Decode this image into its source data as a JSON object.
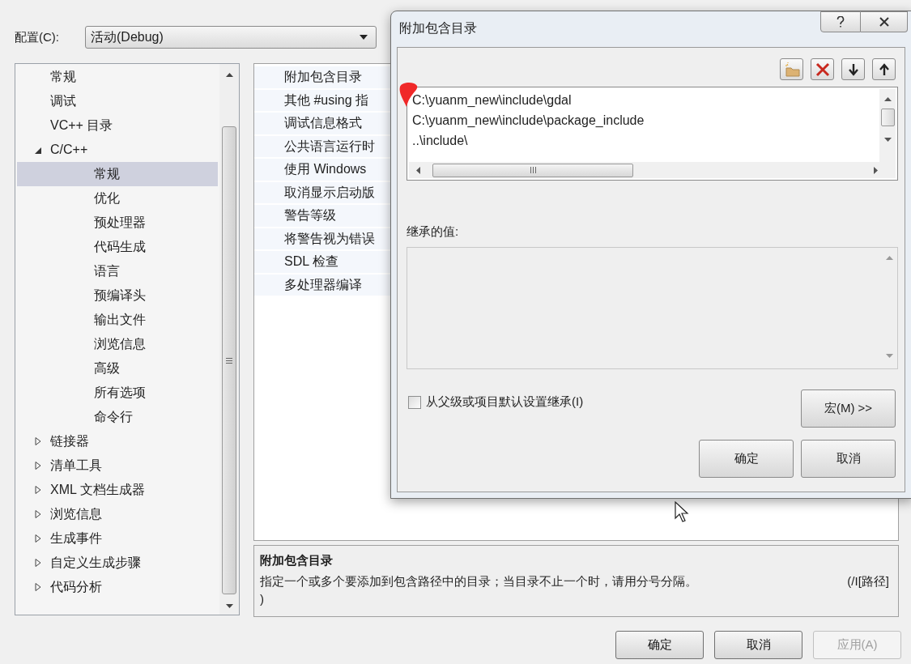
{
  "config": {
    "label": "配置(C):",
    "value": "活动(Debug)"
  },
  "tree": [
    {
      "label": "常规",
      "selected": false
    },
    {
      "label": "调试",
      "selected": false
    },
    {
      "label": "VC++ 目录",
      "selected": false
    },
    {
      "label": "C/C++",
      "selected": false,
      "expanded": true,
      "children": [
        {
          "label": "常规",
          "selected": true
        },
        {
          "label": "优化",
          "selected": false
        },
        {
          "label": "预处理器",
          "selected": false
        },
        {
          "label": "代码生成",
          "selected": false
        },
        {
          "label": "语言",
          "selected": false
        },
        {
          "label": "预编译头",
          "selected": false
        },
        {
          "label": "输出文件",
          "selected": false
        },
        {
          "label": "浏览信息",
          "selected": false
        },
        {
          "label": "高级",
          "selected": false
        },
        {
          "label": "所有选项",
          "selected": false
        },
        {
          "label": "命令行",
          "selected": false
        }
      ]
    },
    {
      "label": "链接器",
      "selected": false,
      "expanded": false
    },
    {
      "label": "清单工具",
      "selected": false,
      "expanded": false
    },
    {
      "label": "XML 文档生成器",
      "selected": false,
      "expanded": false
    },
    {
      "label": "浏览信息",
      "selected": false,
      "expanded": false
    },
    {
      "label": "生成事件",
      "selected": false,
      "expanded": false
    },
    {
      "label": "自定义生成步骤",
      "selected": false,
      "expanded": false
    },
    {
      "label": "代码分析",
      "selected": false,
      "expanded": false
    }
  ],
  "properties": [
    "附加包含目录",
    "其他 #using 指",
    "调试信息格式",
    "公共语言运行时",
    "使用 Windows",
    "取消显示启动版",
    "警告等级",
    "将警告视为错误",
    "SDL 检查",
    "多处理器编译"
  ],
  "description": {
    "title": "附加包含目录",
    "text": "指定一个或多个要添加到包含路径中的目录；当目录不止一个时，请用分号分隔。",
    "switch": "(/I[路径]",
    "continuation": ")"
  },
  "buttons": [
    {
      "label": "确定",
      "disabled": false
    },
    {
      "label": "取消",
      "disabled": false
    },
    {
      "label": "应用(A)",
      "disabled": true
    }
  ],
  "dialog": {
    "title": "附加包含目录",
    "entries": [
      "C:\\yuanm_new\\include\\gdal",
      "C:\\yuanm_new\\include\\package_include",
      "..\\include\\"
    ],
    "inherited_label": "继承的值:",
    "inherit_checkbox": {
      "label": "从父级或项目默认设置继承(I)",
      "checked": false
    },
    "macro_button": "宏(M) >>",
    "buttons": [
      "确定",
      "取消"
    ]
  }
}
